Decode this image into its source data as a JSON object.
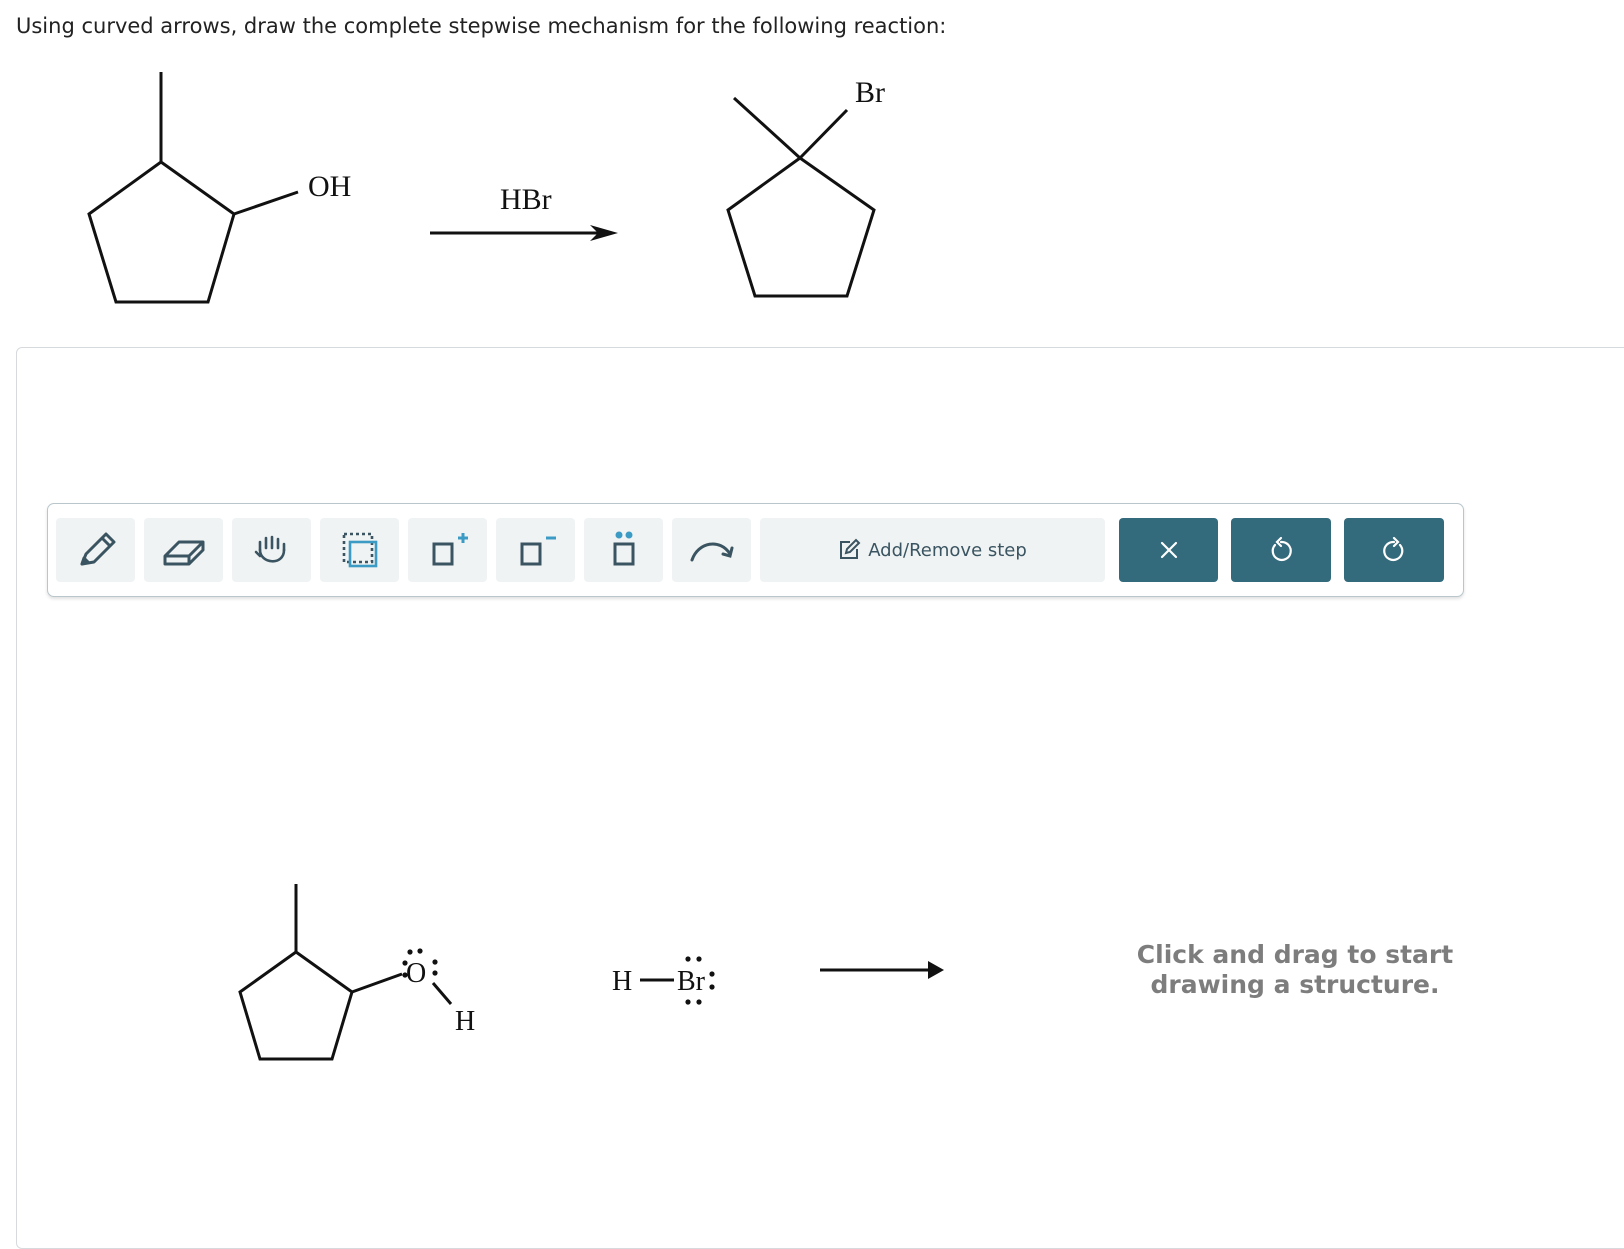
{
  "prompt": "Using curved arrows, draw the complete stepwise mechanism for the following reaction:",
  "reaction": {
    "reactant_group": "OH",
    "reagent": "HBr",
    "product_group": "Br"
  },
  "toolbar": {
    "tools": [
      "pencil-icon",
      "eraser-icon",
      "hand-icon",
      "select-box-icon",
      "add-positive-charge-icon",
      "add-negative-charge-icon",
      "add-lone-pair-icon",
      "curved-arrow-icon"
    ],
    "step_button_label": "Add/Remove step",
    "actions": [
      "clear-icon",
      "undo-icon",
      "redo-icon"
    ],
    "accent_color": "#336b7c"
  },
  "canvas": {
    "alcohol_oxygen": "O",
    "alcohol_hydrogen": "H",
    "acid_hydrogen": "H",
    "acid_bromine": "Br",
    "hint_line1": "Click and drag to start",
    "hint_line2": "drawing a structure."
  }
}
